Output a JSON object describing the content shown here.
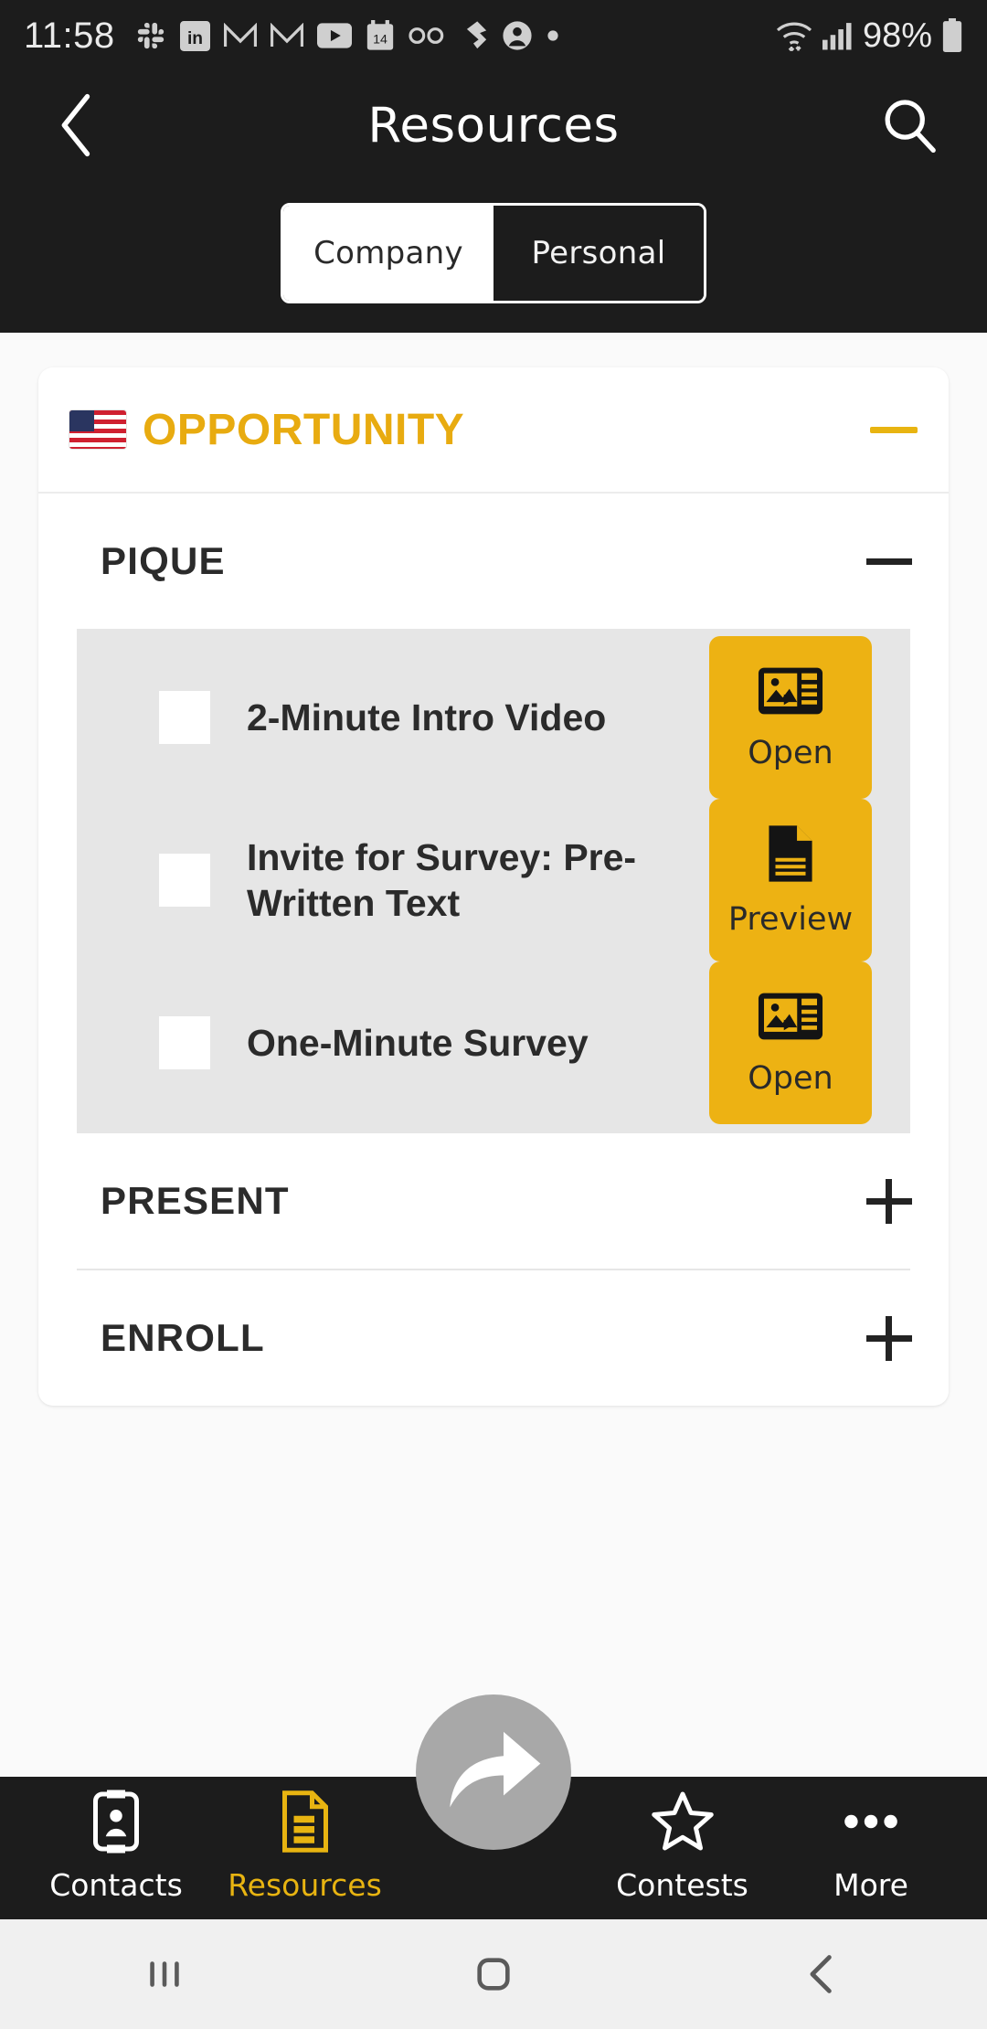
{
  "status_bar": {
    "time": "11:58",
    "battery_percent": "98%",
    "icons": [
      "slack-icon",
      "linkedin-icon",
      "gmail-icon",
      "gmail-icon-2",
      "youtube-icon",
      "calendar-14-icon",
      "voicemail-icon",
      "jira-icon",
      "account-circle-icon",
      "dot-icon"
    ],
    "right_icons": [
      "wifi-icon",
      "cell-signal-icon",
      "battery-icon"
    ]
  },
  "header": {
    "title": "Resources",
    "back_icon": "chevron-left-icon",
    "search_icon": "search-icon",
    "tabs": [
      {
        "label": "Company",
        "active": true
      },
      {
        "label": "Personal",
        "active": false
      }
    ]
  },
  "colors": {
    "accent_gold": "#e8b411",
    "button_gold": "#edb213",
    "dark_bg": "#1c1c1c",
    "panel_gray": "#e6e6e6",
    "page_bg": "#fafafa"
  },
  "main": {
    "opportunity": {
      "flag": "🇺🇸",
      "title": "OPPORTUNITY",
      "toggle_icon": "minus-icon",
      "expanded": true
    },
    "sections": [
      {
        "name": "PIQUE",
        "expanded": true,
        "toggle_icon": "minus-icon",
        "items": [
          {
            "label": "2-Minute Intro Video",
            "checked": false,
            "action_label": "Open",
            "action_icon": "media-slideshow-icon"
          },
          {
            "label": "Invite for Survey: Pre-Written Text",
            "checked": false,
            "action_label": "Preview",
            "action_icon": "document-icon"
          },
          {
            "label": "One-Minute Survey",
            "checked": false,
            "action_label": "Open",
            "action_icon": "media-slideshow-icon"
          }
        ]
      },
      {
        "name": "PRESENT",
        "expanded": false,
        "toggle_icon": "plus-icon",
        "items": []
      },
      {
        "name": "ENROLL",
        "expanded": false,
        "toggle_icon": "plus-icon",
        "items": []
      }
    ]
  },
  "fab": {
    "icon": "share-arrow-icon"
  },
  "bottom_nav": {
    "items": [
      {
        "label": "Contacts",
        "icon": "contact-card-icon",
        "active": false
      },
      {
        "label": "Resources",
        "icon": "document-lines-icon",
        "active": true
      },
      {
        "label": "Contests",
        "icon": "star-icon",
        "active": false
      },
      {
        "label": "More",
        "icon": "ellipsis-icon",
        "active": false
      }
    ]
  },
  "android_nav": {
    "recents_icon": "recents-icon",
    "home_icon": "home-square-icon",
    "back_icon": "back-chevron-icon"
  }
}
